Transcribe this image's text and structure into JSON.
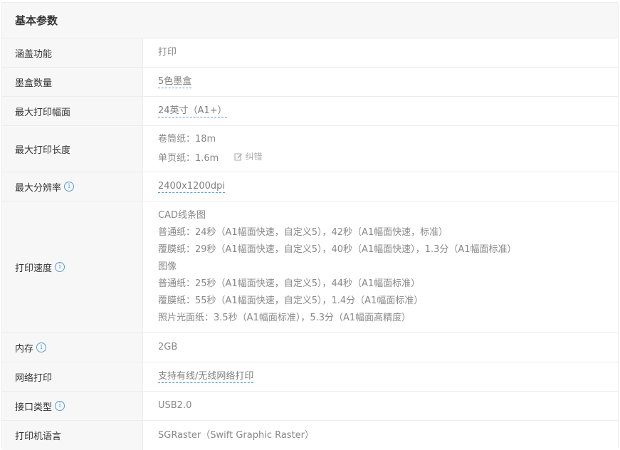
{
  "header": {
    "title": "基本参数"
  },
  "icons": {
    "info": "info-circle-icon",
    "edit": "pencil-edit-icon"
  },
  "colors": {
    "link_underline": "#5b9bd5",
    "key_bg": "#f7f7f7",
    "info": "#5b9bd5"
  },
  "rows": [
    {
      "key": "涵盖功能",
      "lines": [
        "打印"
      ]
    },
    {
      "key": "墨盒数量",
      "lines": [
        "5色墨盒"
      ]
    },
    {
      "key": "最大打印幅面",
      "lines": [
        "24英寸（A1+）"
      ]
    },
    {
      "key": "最大打印长度",
      "lines": [
        "卷筒纸：18m",
        "单页纸：1.6m"
      ],
      "correction": "纠错"
    },
    {
      "key": "最大分辨率",
      "lines": [
        "2400x1200dpi"
      ]
    },
    {
      "key": "打印速度",
      "lines": [
        "CAD线条图",
        "普通纸：24秒（A1幅面快速，自定义5），42秒（A1幅面快速，标准）",
        "覆膜纸：29秒（A1幅面快速，自定义5），40秒（A1幅面快速），1.3分（A1幅面标准）",
        "图像",
        "普通纸：25秒（A1幅面快速，自定义5），44秒（A1幅面标准）",
        "覆膜纸：55秒（A1幅面快速，自定义5），1.4分（A1幅面标准）",
        "照片光面纸：3.5秒（A1幅面标准），5.3分（A1幅面高精度）"
      ]
    },
    {
      "key": "内存",
      "lines": [
        "2GB"
      ]
    },
    {
      "key": "网络打印",
      "lines": [
        "支持有线/无线网络打印"
      ]
    },
    {
      "key": "接口类型",
      "lines": [
        "USB2.0"
      ]
    },
    {
      "key": "打印机语言",
      "lines": [
        "SGRaster（Swift Graphic Raster）"
      ]
    }
  ]
}
